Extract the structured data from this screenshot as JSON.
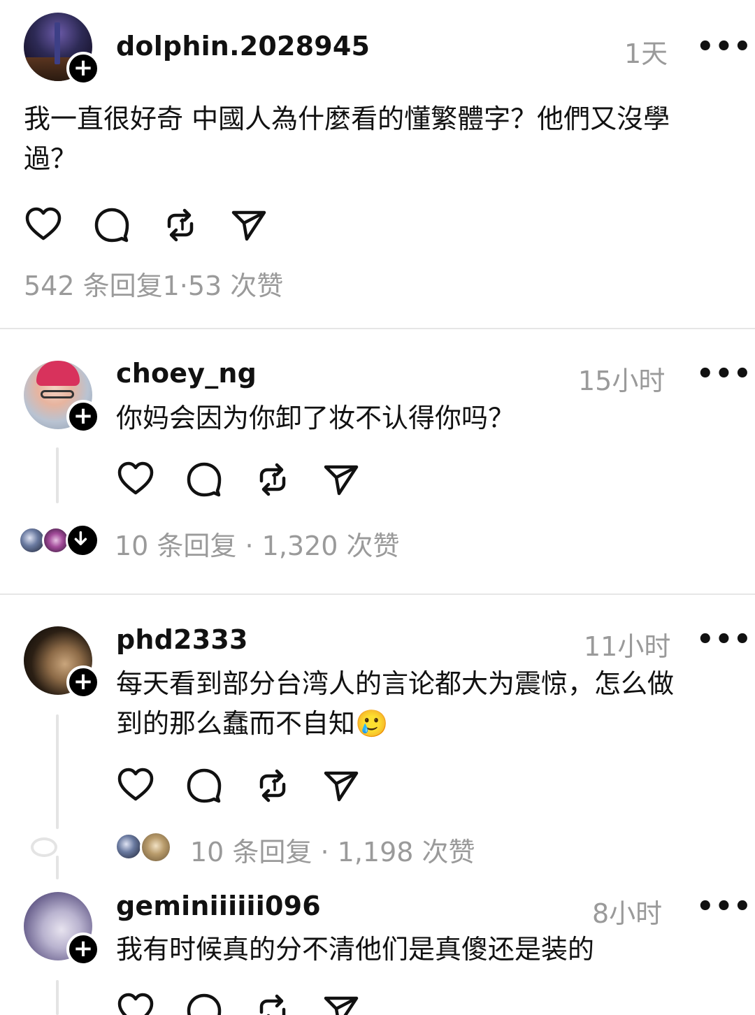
{
  "posts": [
    {
      "username": "dolphin.2028945",
      "time": "1天",
      "more": "•••",
      "text_line1": "我一直很好奇  中國人為什麼看的懂繁體字？他們又沒學",
      "text_line2": "過？",
      "stats": "542 条回复1·53 次赞"
    },
    {
      "username": "choey_ng",
      "time": "15小时",
      "more": "•••",
      "text_line1": "你妈会因为你卸了妆不认得你吗？",
      "stats": "10 条回复 · 1,320 次赞"
    },
    {
      "username": "phd2333",
      "time": "11小时",
      "more": "•••",
      "text_line1": "每天看到部分台湾人的言论都大为震惊，怎么做",
      "text_line2": "到的那么蠢而不自知🥲",
      "stats": "10 条回复 · 1,198 次赞"
    },
    {
      "username": "geminiiiiii096",
      "time": "8小时",
      "more": "•••",
      "text_line1": "我有时候真的分不清他们是真傻还是装的"
    }
  ],
  "icons": {
    "plus": "+",
    "like": "heart-icon",
    "reply": "comment-icon",
    "repost": "repost-icon",
    "share": "send-icon"
  }
}
